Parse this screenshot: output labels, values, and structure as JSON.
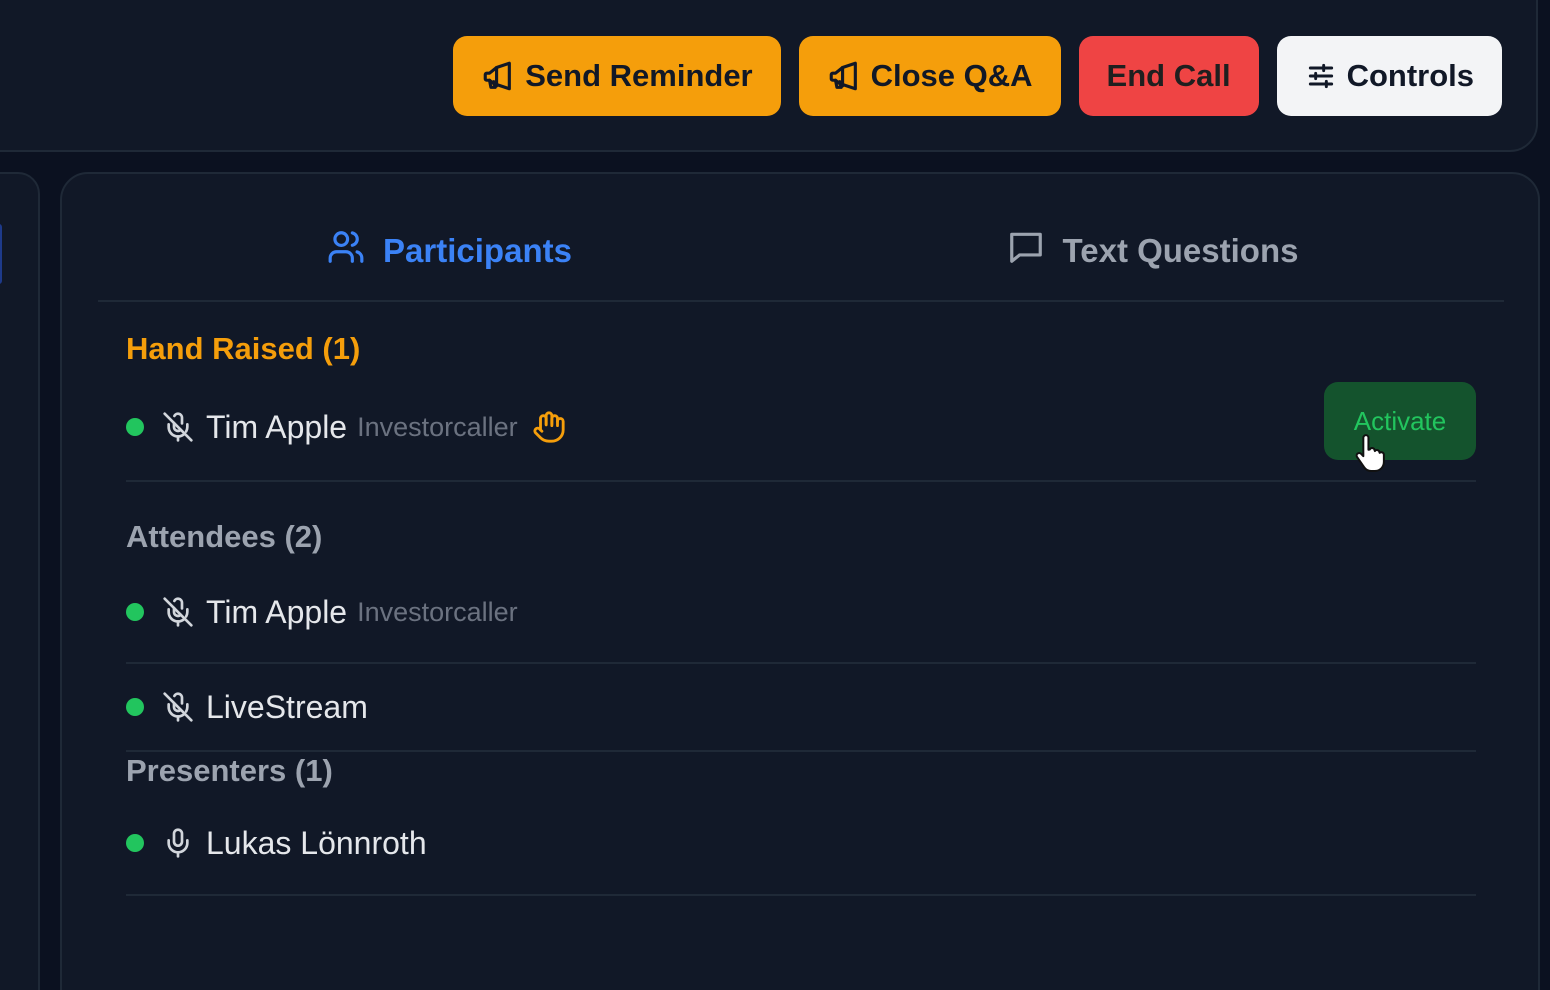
{
  "toolbar": {
    "send_reminder": "Send Reminder",
    "close_qa": "Close Q&A",
    "end_call": "End Call",
    "controls": "Controls"
  },
  "tabs": [
    {
      "label": "Participants",
      "icon": "users-icon",
      "active": true
    },
    {
      "label": "Text Questions",
      "icon": "message-square-icon",
      "active": false
    }
  ],
  "sections": {
    "hand_raised": {
      "title": "Hand Raised (1)",
      "rows": [
        {
          "name": "Tim Apple",
          "role": "Investorcaller",
          "mic": "mic-off-icon",
          "status": "online",
          "hand_icon": "hand-raised-icon",
          "action": "Activate"
        }
      ]
    },
    "attendees": {
      "title": "Attendees (2)",
      "rows": [
        {
          "name": "Tim Apple",
          "role": "Investorcaller",
          "mic": "mic-off-icon",
          "status": "online"
        },
        {
          "name": "LiveStream",
          "role": "",
          "mic": "mic-off-icon",
          "status": "online"
        }
      ]
    },
    "presenters": {
      "title": "Presenters (1)",
      "rows": [
        {
          "name": "Lukas Lönnroth",
          "role": "",
          "mic": "mic-icon",
          "status": "online"
        }
      ]
    }
  },
  "colors": {
    "accent": "#3b82f6",
    "amber": "#f59e0b",
    "danger": "#ef4444",
    "online": "#22c55e",
    "background": "#111827"
  }
}
